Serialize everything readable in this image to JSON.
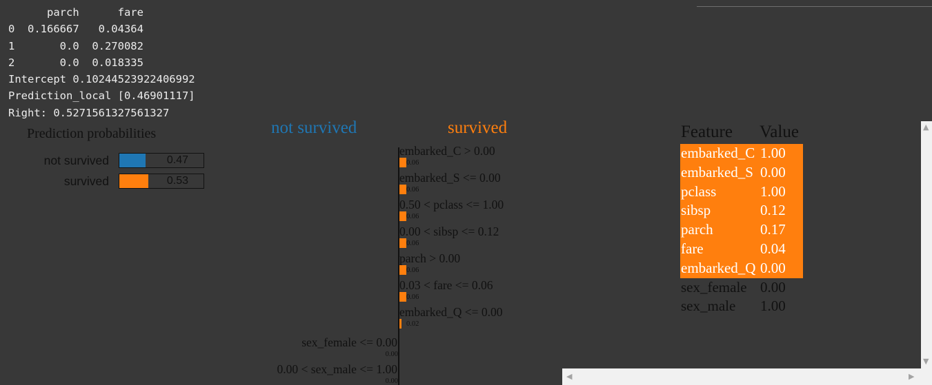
{
  "console": {
    "lines": [
      "      parch      fare",
      "0  0.166667   0.04364",
      "1       0.0  0.270082",
      "2       0.0  0.018335",
      "Intercept 0.10244523922406992",
      "Prediction_local [0.46901117]",
      "Right: 0.5271561327561327"
    ]
  },
  "prediction_probabilities": {
    "title": "Prediction probabilities",
    "rows": [
      {
        "label": "not survived",
        "value": 0.47,
        "display": "0.47",
        "color": "#1f77b4"
      },
      {
        "label": "survived",
        "value": 0.53,
        "display": "0.53",
        "color": "#ff7f0e"
      }
    ]
  },
  "explanation": {
    "negative_class": "not survived",
    "positive_class": "survived",
    "negative_color": "#1f77b4",
    "positive_color": "#ff7f0e",
    "features": [
      {
        "label": "embarked_C > 0.00",
        "weight": 0.06,
        "weight_label": "0.06",
        "side": "positive"
      },
      {
        "label": "embarked_S <= 0.00",
        "weight": 0.06,
        "weight_label": "0.06",
        "side": "positive"
      },
      {
        "label": "0.50 < pclass <= 1.00",
        "weight": 0.06,
        "weight_label": "0.06",
        "side": "positive"
      },
      {
        "label": "0.00 < sibsp <= 0.12",
        "weight": 0.06,
        "weight_label": "0.06",
        "side": "positive"
      },
      {
        "label": "parch > 0.00",
        "weight": 0.06,
        "weight_label": "0.06",
        "side": "positive"
      },
      {
        "label": "0.03 < fare <= 0.06",
        "weight": 0.06,
        "weight_label": "0.06",
        "side": "positive"
      },
      {
        "label": "embarked_Q <= 0.00",
        "weight": 0.02,
        "weight_label": "0.02",
        "side": "positive"
      },
      {
        "label": "sex_female <= 0.00",
        "weight": 0.0,
        "weight_label": "0.00",
        "side": "negative"
      },
      {
        "label": "0.00 < sex_male <= 1.00",
        "weight": 0.0,
        "weight_label": "0.00",
        "side": "negative"
      }
    ]
  },
  "feature_table": {
    "headers": [
      "Feature",
      "Value"
    ],
    "highlight_color": "#ff7f0e",
    "rows": [
      {
        "feature": "embarked_C",
        "value": "1.00",
        "highlighted": true
      },
      {
        "feature": "embarked_S",
        "value": "0.00",
        "highlighted": true
      },
      {
        "feature": "pclass",
        "value": "1.00",
        "highlighted": true
      },
      {
        "feature": "sibsp",
        "value": "0.12",
        "highlighted": true
      },
      {
        "feature": "parch",
        "value": "0.17",
        "highlighted": true
      },
      {
        "feature": "fare",
        "value": "0.04",
        "highlighted": true
      },
      {
        "feature": "embarked_Q",
        "value": "0.00",
        "highlighted": true
      },
      {
        "feature": "sex_female",
        "value": "0.00",
        "highlighted": false
      },
      {
        "feature": "sex_male",
        "value": "1.00",
        "highlighted": false
      }
    ]
  },
  "scrollbars": {
    "left_arrow": "◀",
    "right_arrow": "▶",
    "up_arrow": "▲",
    "down_arrow": "▼"
  }
}
